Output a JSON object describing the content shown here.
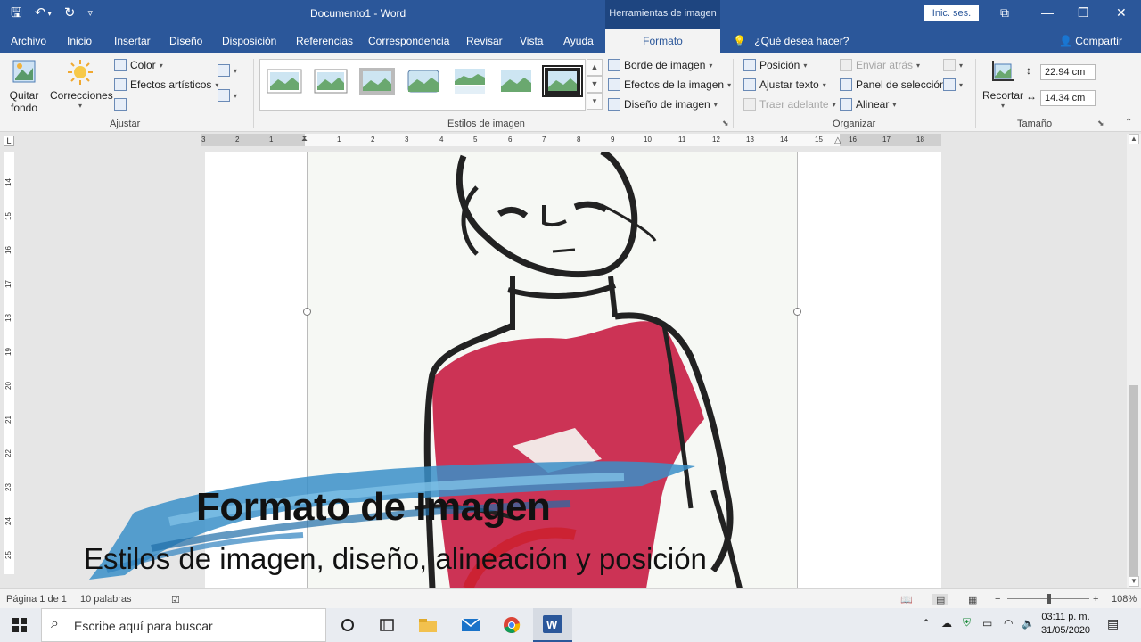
{
  "window": {
    "doc_title": "Documento1  -  Word",
    "context_tab_header": "Herramientas de imagen",
    "signin_label": "Inic. ses.",
    "minimize_glyph": "—",
    "restore_glyph": "❐",
    "close_glyph": "✕",
    "ribbon_display_glyph": "⧉"
  },
  "qat": {
    "save_glyph": "🖫",
    "undo_glyph": "↶",
    "undo_caret": "▾",
    "redo_glyph": "↻",
    "customize_glyph": "▿"
  },
  "tabs": [
    {
      "label": "Archivo"
    },
    {
      "label": "Inicio"
    },
    {
      "label": "Insertar"
    },
    {
      "label": "Diseño"
    },
    {
      "label": "Disposición"
    },
    {
      "label": "Referencias"
    },
    {
      "label": "Correspondencia"
    },
    {
      "label": "Revisar"
    },
    {
      "label": "Vista"
    },
    {
      "label": "Ayuda"
    }
  ],
  "active_tab": "Formato",
  "tell_me": "¿Qué desea hacer?",
  "share": "Compartir",
  "ribbon": {
    "ajustar": {
      "label": "Ajustar",
      "quitar_fondo_1": "Quitar",
      "quitar_fondo_2": "fondo",
      "correcciones": "Correcciones",
      "color": "Color",
      "efectos_artisticos": "Efectos artísticos"
    },
    "estilos": {
      "label": "Estilos de imagen",
      "borde": "Borde de imagen",
      "efectos": "Efectos de la imagen",
      "diseno": "Diseño de imagen"
    },
    "organizar": {
      "label": "Organizar",
      "posicion": "Posición",
      "ajustar_texto": "Ajustar texto",
      "traer_adelante": "Traer adelante",
      "enviar_atras": "Enviar atrás",
      "panel_seleccion": "Panel de selección",
      "alinear": "Alinear"
    },
    "tamano": {
      "label": "Tamaño",
      "recortar": "Recortar",
      "alto": "22.94 cm",
      "ancho": "14.34 cm"
    }
  },
  "ruler": {
    "h_ticks": [
      "3",
      "2",
      "1",
      "1",
      "2",
      "3",
      "4",
      "5",
      "6",
      "7",
      "8",
      "9",
      "10",
      "11",
      "12",
      "13",
      "14",
      "15",
      "16",
      "17",
      "18"
    ],
    "v_ticks": [
      "14",
      "15",
      "16",
      "17",
      "18",
      "19",
      "20",
      "21",
      "22",
      "23",
      "24",
      "25"
    ]
  },
  "overlay": {
    "title": "Formato de Imagen",
    "subtitle": "Estilos de imagen, diseño, alineación y posición"
  },
  "status": {
    "page": "Página 1 de 1",
    "words": "10 palabras",
    "zoom": "108%"
  },
  "taskbar": {
    "search_placeholder": "Escribe aquí para buscar",
    "time": "03:11 p. m.",
    "date": "31/05/2020"
  },
  "colors": {
    "word_blue": "#2b579a",
    "ribbon_bg": "#f3f3f3",
    "shirt": "#cc3355",
    "brush_blue": "#3a8fc8"
  }
}
